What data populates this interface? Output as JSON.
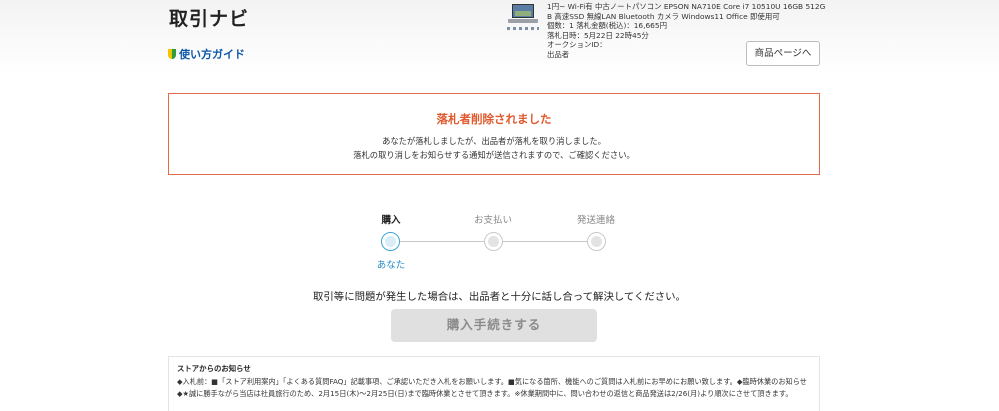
{
  "header": {
    "title": "取引ナビ",
    "guide_link": "使い方ガイド"
  },
  "item": {
    "title_line1": "1円~ Wi-Fi有 中古ノートパソコン EPSON NA710E Core i7 10510U 16GB 512G",
    "title_line2": "B 高速SSD 無線LAN Bluetooth カメラ Windows11 Office 即使用可",
    "quantity_price": "個数：1  落札金額(税込)：16,665円",
    "end_time": "落札日時：5月22日 22時45分",
    "auction_id": "オークションID：",
    "seller": "出品者",
    "product_page_button": "商品ページへ"
  },
  "notice": {
    "title": "落札者削除されました",
    "line1": "あなたが落札しましたが、出品者が落札を取り消しました。",
    "line2": "落札の取り消しをお知らせする通知が送信されますので、ご確認ください。"
  },
  "steps": {
    "labels": [
      "購入",
      "お支払い",
      "発送連絡"
    ],
    "current_index": 0,
    "you_label": "あなた"
  },
  "problem_message": "取引等に問題が発生した場合は、出品者と十分に話し合って解決してください。",
  "purchase_button": "購入手続きする",
  "store_notice": {
    "title": "ストアからのお知らせ",
    "body": "◆入札前：■「ストア利用案内」「よくある質問FAQ」記載事項、ご承認いただき入札をお願いします。■気になる箇所、機能へのご質問は入札前にお早めにお願い致します。◆臨時休業のお知らせ◆★誠に勝手ながら当店は社員旅行のため、2月15日(木)～2月25日(日)まで臨時休業とさせて頂きます。※休業期間中に、問い合わせの返信と商品発送は2/26(月)より順次にさせて頂きます。"
  },
  "colors": {
    "alert": "#e05a2f",
    "active_step": "#3ea3d2",
    "link": "#0b57a8"
  }
}
